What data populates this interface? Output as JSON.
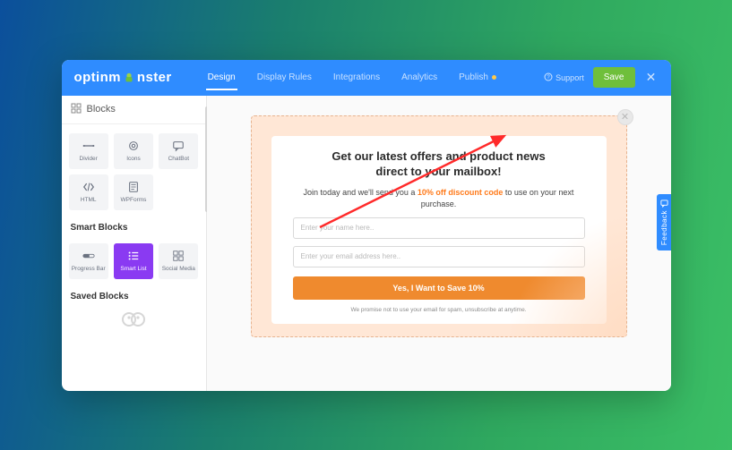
{
  "brand": {
    "name_a": "optinm",
    "name_b": "nster"
  },
  "nav": {
    "design": "Design",
    "display_rules": "Display Rules",
    "integrations": "Integrations",
    "analytics": "Analytics",
    "publish": "Publish"
  },
  "top": {
    "support": "Support",
    "save": "Save"
  },
  "sidebar": {
    "blocks_title": "Blocks",
    "blocks": {
      "divider": "Divider",
      "icons": "Icons",
      "chatbot": "ChatBot",
      "html": "HTML",
      "wpforms": "WPForms"
    },
    "smart_title": "Smart Blocks",
    "smart": {
      "progress": "Progress Bar",
      "smart_list": "Smart List",
      "social": "Social Media"
    },
    "saved_title": "Saved Blocks"
  },
  "popup": {
    "heading_l1": "Get our latest offers and product news",
    "heading_l2": "direct to your mailbox!",
    "sub_pre": "Join today and we'll send you a ",
    "sub_hl": "10% off discount code",
    "sub_post": " to use on your next purchase.",
    "name_ph": "Enter your name here..",
    "email_ph": "Enter your email address here..",
    "cta": "Yes, I Want to Save 10%",
    "disclaimer": "We promise not to use your email for spam, unsubscribe at anytime."
  },
  "feedback": "Feedback"
}
